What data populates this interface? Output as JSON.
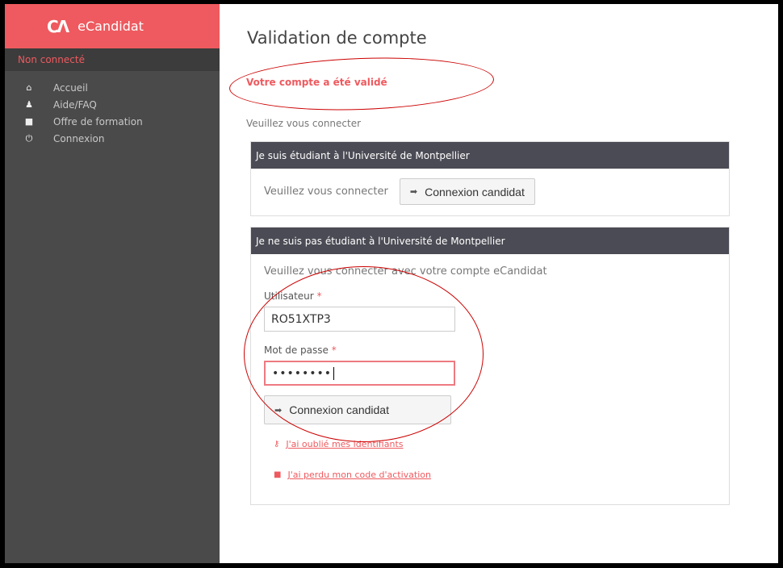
{
  "app": {
    "logo_text": "ϹΛ",
    "name": "eCandidat",
    "status": "Non connecté"
  },
  "sidebar": {
    "items": [
      {
        "label": "Accueil",
        "icon": "home-icon",
        "glyph": "⌂"
      },
      {
        "label": "Aide/FAQ",
        "icon": "users-icon",
        "glyph": "♟"
      },
      {
        "label": "Offre de formation",
        "icon": "bookmark-icon",
        "glyph": "■"
      },
      {
        "label": "Connexion",
        "icon": "power-icon",
        "glyph": "⏻"
      }
    ]
  },
  "main": {
    "title": "Validation de compte",
    "validated_message": "Votre compte a été validé",
    "please_connect": "Veuillez vous connecter",
    "panel_student": {
      "heading": "Je suis étudiant à l'Université de Montpellier",
      "prompt": "Veuillez vous connecter",
      "button_label": "Connexion candidat",
      "button_icon": "sign-in-icon"
    },
    "panel_external": {
      "heading": "Je ne suis pas étudiant à l'Université de Montpellier",
      "intro": "Veuillez vous connecter avec votre compte eCandidat",
      "user_label": "Utilisateur",
      "user_value": "RO51XTP3",
      "password_label": "Mot de passe",
      "password_value": "••••••••",
      "required_mark": "*",
      "button_label": "Connexion candidat",
      "forgot_ids": "J'ai oublié mes identifiants",
      "lost_code": "J'ai perdu mon code d'activation"
    }
  },
  "colors": {
    "accent": "#ee5a5f",
    "sidebar_bg": "#4a4a4a",
    "panel_head_bg": "#4b4b55",
    "annotation": "#cc0000"
  }
}
